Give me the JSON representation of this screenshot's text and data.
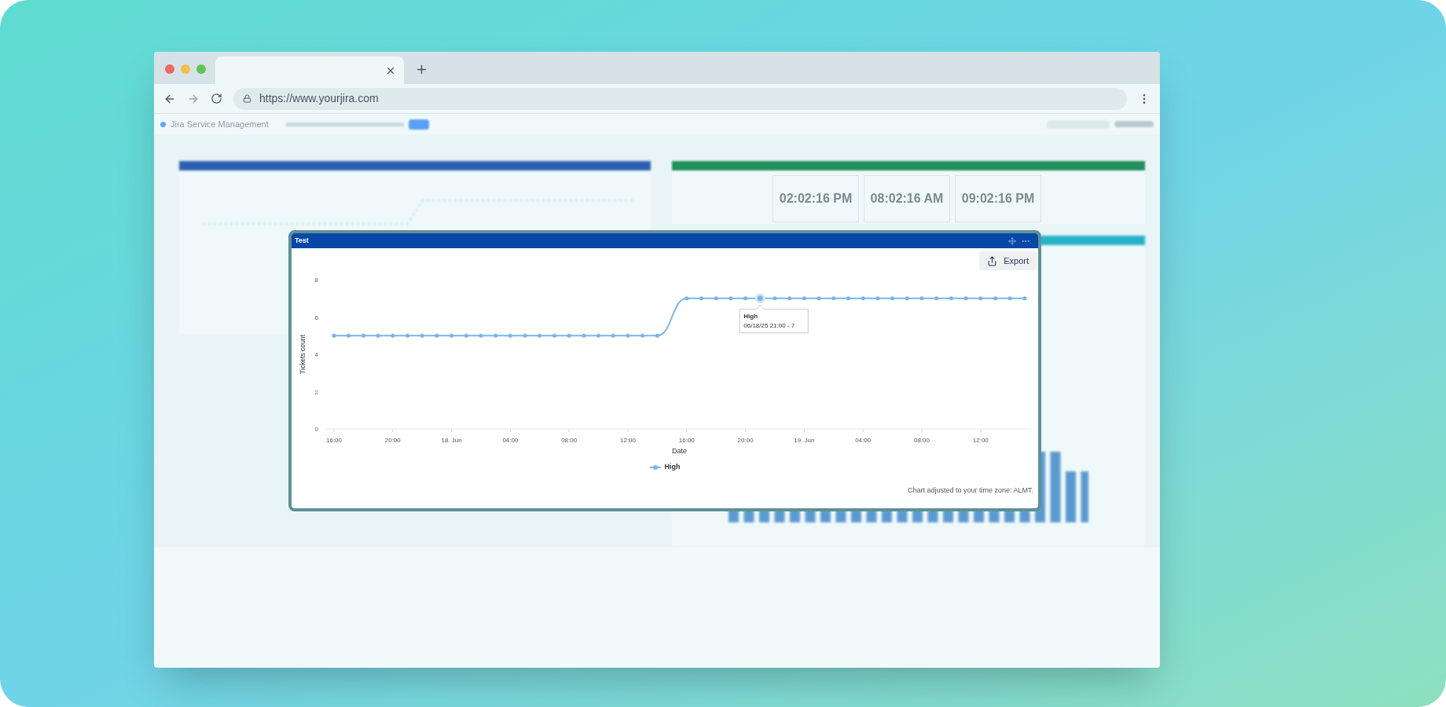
{
  "browser": {
    "url": "https://www.yourjira.com"
  },
  "dashboard": {
    "app_title": "Jira Service Management",
    "clocks": [
      {
        "time": "02:02:16 PM"
      },
      {
        "time": "08:02:16 AM"
      },
      {
        "time": "09:02:16 PM"
      }
    ]
  },
  "widget": {
    "title": "Test",
    "export_button": "Export",
    "chart_data": {
      "type": "line",
      "xlabel": "Date",
      "ylabel": "Tickets count",
      "categories": [
        "16:00",
        null,
        null,
        null,
        "20:00",
        null,
        null,
        null,
        "18. Jun",
        null,
        null,
        null,
        "04:00",
        null,
        null,
        null,
        "08:00",
        null,
        null,
        null,
        "12:00",
        null,
        null,
        null,
        "16:00",
        null,
        null,
        null,
        "20:00",
        null,
        null,
        null,
        "19. Jun",
        null,
        null,
        null,
        "04:00",
        null,
        null,
        null,
        "08:00",
        null,
        null,
        null,
        "12:00",
        null,
        null,
        null
      ],
      "series": [
        {
          "name": "High",
          "color": "#7cb5ec",
          "values": [
            5,
            5,
            5,
            5,
            5,
            5,
            5,
            5,
            5,
            5,
            5,
            5,
            5,
            5,
            5,
            5,
            5,
            5,
            5,
            5,
            5,
            5,
            5,
            null,
            7,
            7,
            7,
            7,
            7,
            7,
            7,
            7,
            7,
            7,
            7,
            7,
            7,
            7,
            7,
            7,
            7,
            7,
            7,
            7,
            7,
            7,
            7,
            7
          ]
        }
      ],
      "ylim": [
        0,
        8
      ],
      "yticks": [
        0,
        2,
        4,
        6,
        8
      ]
    },
    "tooltip": {
      "title": "High",
      "text": "06/18/25 21:00 - 7"
    },
    "note": "Chart adjusted to your time zone: ALMT."
  }
}
